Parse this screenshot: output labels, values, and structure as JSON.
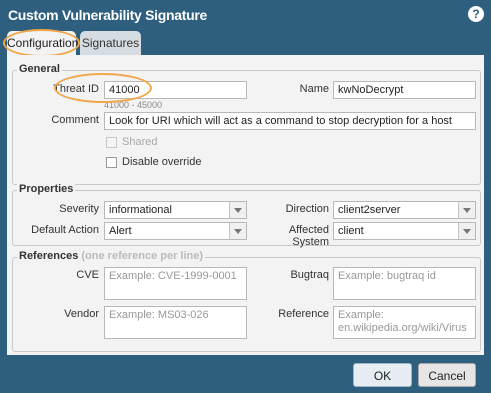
{
  "dialog": {
    "title": "Custom Vulnerability Signature",
    "help_icon": "question-icon"
  },
  "tabs": [
    {
      "label": "Configuration",
      "active": true
    },
    {
      "label": "Signatures",
      "active": false
    }
  ],
  "general": {
    "title": "General",
    "threat_id": {
      "label": "Threat ID",
      "value": "41000",
      "hint": "41000 - 45000"
    },
    "name": {
      "label": "Name",
      "value": "kwNoDecrypt"
    },
    "comment": {
      "label": "Comment",
      "value": "Look for URI which will act as a command to stop decryption for a host"
    },
    "shared": {
      "label": "Shared",
      "checked": false,
      "disabled": true
    },
    "disable_override": {
      "label": "Disable override",
      "checked": false
    }
  },
  "properties": {
    "title": "Properties",
    "severity": {
      "label": "Severity",
      "value": "informational"
    },
    "direction": {
      "label": "Direction",
      "value": "client2server"
    },
    "default_action": {
      "label": "Default Action",
      "value": "Alert"
    },
    "affected_system": {
      "label": "Affected System",
      "value": "client"
    }
  },
  "references": {
    "title": "References",
    "hint": "(one reference per line)",
    "cve": {
      "label": "CVE",
      "placeholder": "Example: CVE-1999-0001"
    },
    "bugtraq": {
      "label": "Bugtraq",
      "placeholder": "Example: bugtraq id"
    },
    "vendor": {
      "label": "Vendor",
      "placeholder": "Example: MS03-026"
    },
    "reference": {
      "label": "Reference",
      "placeholder": "Example:\nen.wikipedia.org/wiki/Virus"
    }
  },
  "buttons": {
    "ok": "OK",
    "cancel": "Cancel"
  },
  "colors": {
    "background": "#2e5f7e",
    "highlight": "#f1a64a"
  }
}
